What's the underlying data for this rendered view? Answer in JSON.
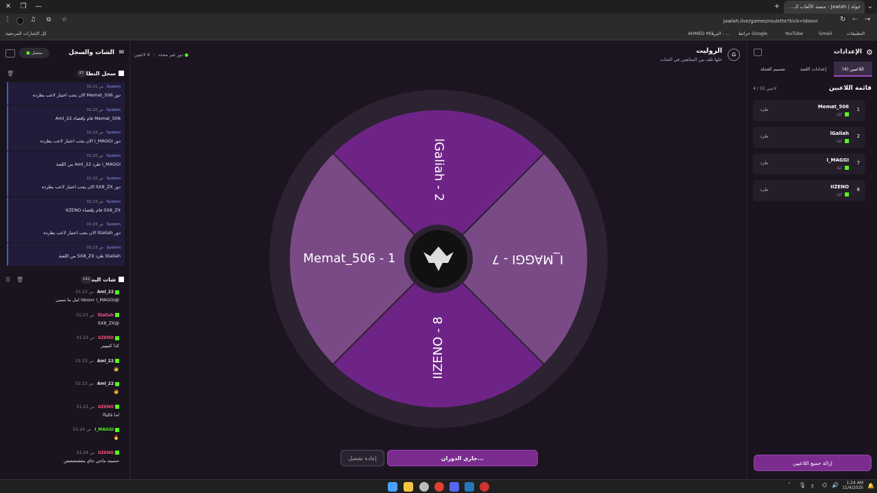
{
  "browser": {
    "tab_title": "جولة | Jawlah - منصة الألعاب الـ...",
    "url": "jawlah.live/games/roulette?kick=ldoovr",
    "bookmarks": {
      "apps": "التطبيقات",
      "gmail": "Gmail",
      "youtube": "YouTube",
      "maps": "خرائط Google",
      "mail": "البريد - ...",
      "ahmed": "AHMED MO...",
      "all": "كل الإشارات المرجعية"
    }
  },
  "header": {
    "title": "الروليت",
    "subtitle": "خلها تلف بين المتابعين في الشات",
    "player_count": "4 لاعبين",
    "turn": "دور غير محدد"
  },
  "left": {
    "title": "الشات والسجل",
    "status": "متصل",
    "system_log_title": "سجل النظام",
    "system_log_count": "87",
    "system_items": [
      {
        "sender": "System",
        "time": "01:21 ص",
        "msg": "دور Memat_506 الان يجب اختيار لاعب يطرده"
      },
      {
        "sender": "System",
        "time": "01:22 ص",
        "msg": "Memat_506 قام بإقصاء Aml_22"
      },
      {
        "sender": "System",
        "time": "01:22 ص",
        "msg": "دور I_MAGGI الان يجب اختيار لاعب يطرده"
      },
      {
        "sender": "System",
        "time": "01:22 ص",
        "msg": "I_MAGGI طرد Aml_22 من اللعبة"
      },
      {
        "sender": "System",
        "time": "01:22 ص",
        "msg": "دور SX8_ZX الان يجب اختيار لاعب يطرده"
      },
      {
        "sender": "System",
        "time": "01:23 ص",
        "msg": "SX8_ZX قام بإقصاء IIZENO"
      },
      {
        "sender": "System",
        "time": "01:23 ص",
        "msg": "دور lGaliah الان يجب اختيار لاعب يطرده"
      },
      {
        "sender": "System",
        "time": "01:23 ص",
        "msg": "lGaliah طرد SX8_ZX من اللعبة"
      }
    ],
    "live_chat_title": "شات البث",
    "live_chat_count": "142",
    "chat_items": [
      {
        "user": "Aml_22",
        "color": "#e8e0ee",
        "time": "01:23 ص",
        "msg": "@ldoovr I_MAGGI امل ما تنسى"
      },
      {
        "user": "lGaliah",
        "color": "#ff4fa0",
        "time": "01:23 ص",
        "msg": "@SX8_ZX"
      },
      {
        "user": "IIZENO",
        "color": "#ff4f7a",
        "time": "01:23 ص",
        "msg": "كذا كثيييير"
      },
      {
        "user": "Aml_22",
        "color": "#e8e0ee",
        "time": "01:23 ص",
        "msg": "🧑"
      },
      {
        "user": "Aml_22",
        "color": "#e8e0ee",
        "time": "01:23 ص",
        "msg": "🧑"
      },
      {
        "user": "IIZENO",
        "color": "#ff4f7a",
        "time": "01:23 ص",
        "msg": "اما غاليااا"
      },
      {
        "user": "I_MAGGI",
        "color": "#53fc18",
        "time": "01:24 ص",
        "msg": "🔥"
      },
      {
        "user": "IIZENO",
        "color": "#ff4f7a",
        "time": "01:24 ص",
        "msg": "حسيته ماجي جاي مقصصصص"
      }
    ]
  },
  "wheel": {
    "segments": [
      {
        "label": "lGaliah - 2",
        "color": "#6e2486"
      },
      {
        "label": "I_MAGGI - 7",
        "color": "#7a4a86"
      },
      {
        "label": "IIZENO - 8",
        "color": "#6e2486"
      },
      {
        "label": "Memat_506 - 1",
        "color": "#7a4a86"
      }
    ]
  },
  "controls": {
    "spinning": "جاري الدوران...",
    "restart": "إعادة تشغيل"
  },
  "right": {
    "title": "الإعدادات",
    "tabs": [
      "اللاعبين (4)",
      "إعدادات اللعبة",
      "تصميم العجلة"
    ],
    "list_title": "قائمة اللاعبين",
    "list_count": "4 / 32 لاعبين",
    "kick_label": "طرد",
    "platform": "كيك",
    "players": [
      {
        "num": "1",
        "name": "Memat_506"
      },
      {
        "num": "2",
        "name": "lGaliah"
      },
      {
        "num": "7",
        "name": "I_MAGGI"
      },
      {
        "num": "8",
        "name": "IIZENO"
      }
    ],
    "remove_all": "إزالة جميع اللاعبين"
  },
  "taskbar": {
    "time": "1:24 AM",
    "date": "11/4/2025",
    "lang": "ع"
  },
  "colors": {
    "accent": "#7b2c8f",
    "kick_green": "#53fc18"
  }
}
